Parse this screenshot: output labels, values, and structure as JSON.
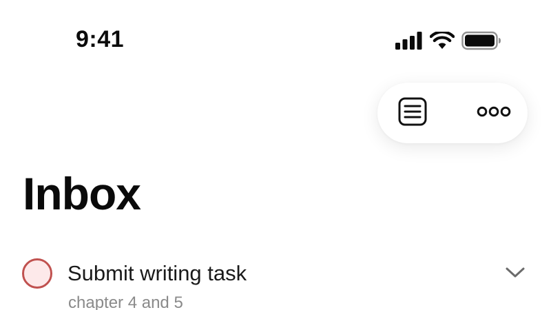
{
  "status_bar": {
    "time": "9:41",
    "icons": [
      "cellular-signal-icon",
      "wifi-icon",
      "battery-icon"
    ]
  },
  "toolbar": {
    "buttons": [
      {
        "icon": "list-document-icon"
      },
      {
        "icon": "more-ellipsis-icon"
      }
    ]
  },
  "page": {
    "title": "Inbox"
  },
  "tasks": [
    {
      "title": "Submit writing task",
      "note": "chapter 4 and 5",
      "completed": false,
      "checkbox_color": "#c0514f",
      "checkbox_fill": "#fde9ea",
      "expand_icon": "chevron-down-icon"
    }
  ],
  "colors": {
    "background": "#ffffff",
    "text_primary": "#111111",
    "text_secondary": "#8a8a8a",
    "accent_red": "#c0514f"
  }
}
